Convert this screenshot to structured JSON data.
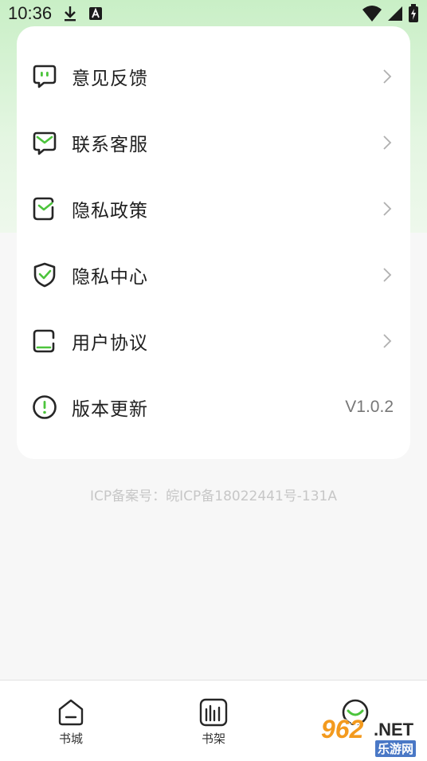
{
  "status_bar": {
    "time": "10:36",
    "icons": [
      "download-icon",
      "a-icon",
      "wifi-icon",
      "signal-icon",
      "battery-icon"
    ]
  },
  "menu": {
    "items": [
      {
        "label": "意见反馈",
        "icon": "feedback-icon"
      },
      {
        "label": "联系客服",
        "icon": "customer-service-icon"
      },
      {
        "label": "隐私政策",
        "icon": "privacy-policy-icon"
      },
      {
        "label": "隐私中心",
        "icon": "shield-check-icon"
      },
      {
        "label": "用户协议",
        "icon": "user-agreement-icon"
      },
      {
        "label": "版本更新",
        "icon": "exclamation-icon",
        "value": "V1.0.2"
      }
    ]
  },
  "icp_text": "ICP备案号：皖ICP备18022441号-131A",
  "bottom_nav": {
    "items": [
      {
        "label": "书城",
        "icon": "home-icon"
      },
      {
        "label": "书架",
        "icon": "bookshelf-icon"
      },
      {
        "label": "",
        "icon": "profile-icon",
        "active": true
      }
    ]
  },
  "watermark": {
    "number": "962",
    "suffix": ".NET",
    "sub": "乐游网"
  },
  "colors": {
    "accent": "#4cc43c",
    "icon_dark": "#262626",
    "header_green": "#c9efc6"
  }
}
